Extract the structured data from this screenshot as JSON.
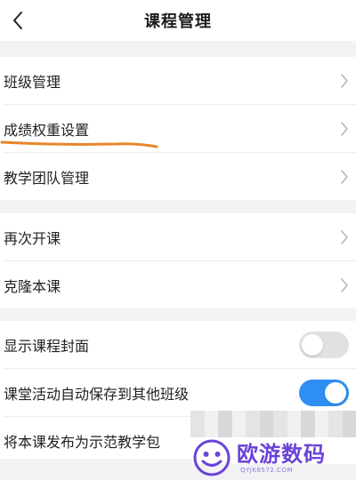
{
  "header": {
    "title": "课程管理",
    "back_icon": "chevron-left-icon"
  },
  "groups": [
    {
      "items": [
        {
          "label": "班级管理",
          "control": "chevron"
        },
        {
          "label": "成绩权重设置",
          "control": "chevron"
        },
        {
          "label": "教学团队管理",
          "control": "chevron"
        }
      ]
    },
    {
      "items": [
        {
          "label": "再次开课",
          "control": "chevron"
        },
        {
          "label": "克隆本课",
          "control": "chevron"
        }
      ]
    },
    {
      "items": [
        {
          "label": "显示课程封面",
          "control": "toggle",
          "enabled": false
        },
        {
          "label": "课堂活动自动保存到其他班级",
          "control": "toggle",
          "enabled": true
        },
        {
          "label": "将本课发布为示范教学包",
          "control": "none"
        }
      ]
    }
  ],
  "annotation": {
    "color": "#e8862a"
  },
  "watermark": {
    "brand": "欧游数码",
    "url": "QYJK6572.COM",
    "color": "#6a43d8"
  },
  "colors": {
    "toggle_on": "#2f8ef3",
    "toggle_off": "#e1e1e4",
    "background": "#f2f2f4"
  }
}
